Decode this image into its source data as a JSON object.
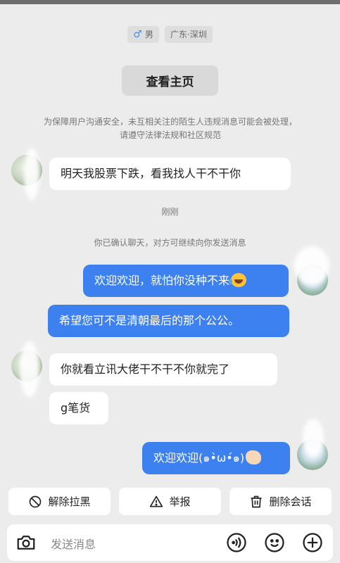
{
  "profile": {
    "gender_symbol": "♂",
    "gender": "男",
    "location": "广东·深圳"
  },
  "home_button_label": "查看主页",
  "notice": "为保障用户沟通安全，未互相关注的陌生人违规消息可能会被处理，请遵守法律法规和社区规范",
  "messages": [
    {
      "side": "left",
      "text": "明天我股票下跌，看我找人干不干你"
    },
    {
      "side": "right",
      "text": "欢迎欢迎，就怕你没种不来"
    },
    {
      "side": "right",
      "text": "希望您可不是清朝最后的那个公公。"
    },
    {
      "side": "left",
      "text": "你就看立讯大佬干不干不你就完了"
    },
    {
      "side": "left",
      "text": "g笔货"
    },
    {
      "side": "right",
      "text": "欢迎欢迎(๑•̀ω•́๑)"
    }
  ],
  "system": {
    "time": "刚刚",
    "confirm": "你已确认聊天，对方可继续向你发送消息"
  },
  "actions": [
    {
      "label": "解除拉黑",
      "icon": "unblock-icon"
    },
    {
      "label": "举报",
      "icon": "warning-icon"
    },
    {
      "label": "删除会话",
      "icon": "trash-icon"
    }
  ],
  "input": {
    "placeholder": "发送消息",
    "icons": [
      "camera-icon",
      "voice-icon",
      "emoji-icon",
      "plus-icon"
    ]
  },
  "colors": {
    "self_bubble": "#3d80f0",
    "other_bubble": "#ffffff",
    "background": "#ececec"
  }
}
